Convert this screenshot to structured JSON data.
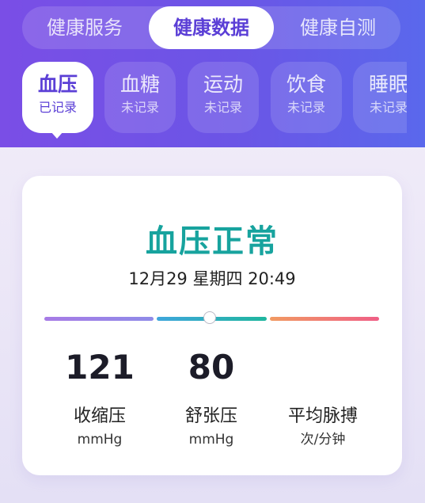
{
  "tabs": [
    {
      "label": "健康服务"
    },
    {
      "label": "健康数据"
    },
    {
      "label": "健康自测"
    }
  ],
  "active_tab": "健康数据",
  "categories": [
    {
      "name": "血压",
      "status": "已记录"
    },
    {
      "name": "血糖",
      "status": "未记录"
    },
    {
      "name": "运动",
      "status": "未记录"
    },
    {
      "name": "饮食",
      "status": "未记录"
    },
    {
      "name": "睡眠",
      "status": "未记录"
    }
  ],
  "active_category": "血压",
  "card": {
    "status_title": "血压正常",
    "datetime": "12月29 星期四 20:49",
    "metrics": [
      {
        "value": "121",
        "label": "收缩压",
        "unit": "mmHg"
      },
      {
        "value": "80",
        "label": "舒张压",
        "unit": "mmHg"
      },
      {
        "value": "",
        "label": "平均脉搏",
        "unit": "次/分钟"
      }
    ]
  },
  "colors": {
    "header_start": "#7a4ee6",
    "header_end": "#5a68ec",
    "accent": "#5b3fd6",
    "status_normal": "#17a39e"
  }
}
